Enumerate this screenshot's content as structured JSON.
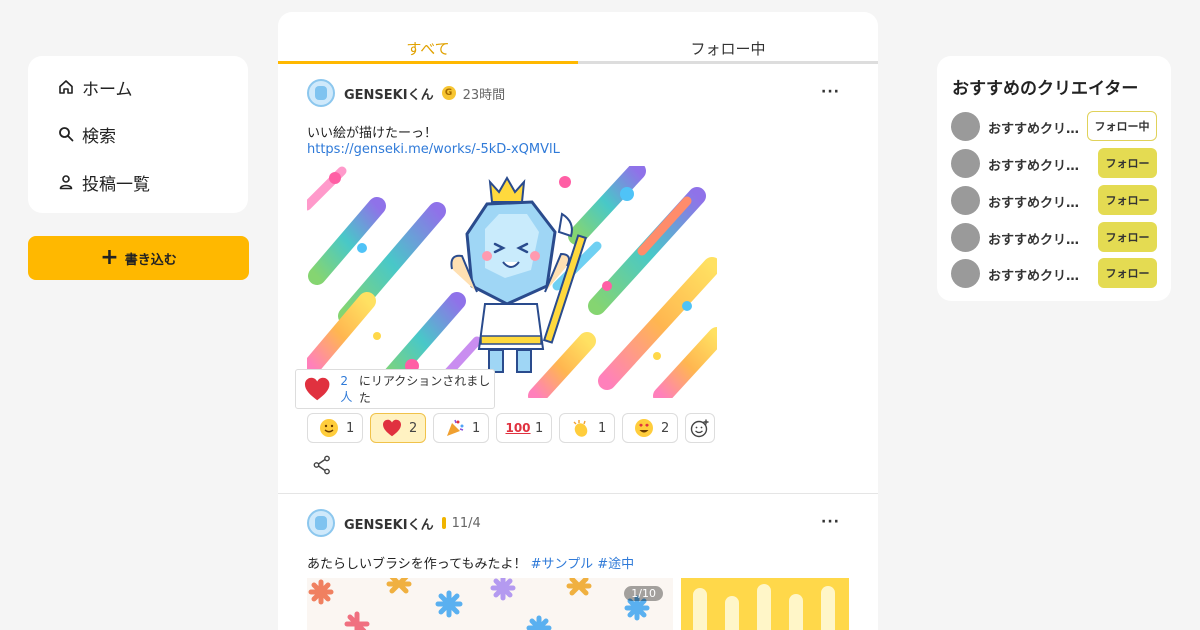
{
  "nav": {
    "home": "ホーム",
    "search": "検索",
    "posts": "投稿一覧",
    "write": "書き込む"
  },
  "tabs": {
    "all": "すべて",
    "following": "フォロー中"
  },
  "posts": [
    {
      "author": "GENSEKIくん",
      "badge": "G",
      "time": "23時間",
      "text": "いい絵が描けたーっ！",
      "link": "https://genseki.me/works/-5kD-xQMVlL",
      "reaction_summary_count": "2人",
      "reaction_summary_text": "にリアクションされました",
      "reactions": [
        {
          "emoji": "smile",
          "count": "1",
          "active": false
        },
        {
          "emoji": "heart",
          "count": "2",
          "active": true
        },
        {
          "emoji": "party",
          "count": "1",
          "active": false
        },
        {
          "emoji": "hundred",
          "count": "1",
          "active": false
        },
        {
          "emoji": "clap",
          "count": "1",
          "active": false
        },
        {
          "emoji": "heart-eyes",
          "count": "2",
          "active": false
        }
      ]
    },
    {
      "author": "GENSEKIくん",
      "time": "11/4",
      "text": "あたらしいブラシを作ってもみたよ！",
      "tag1": "#サンプル",
      "tag2": "#途中",
      "pager": "1/10"
    }
  ],
  "recommend": {
    "title": "おすすめのクリエイター",
    "creators": [
      {
        "name": "おすすめクリエイター",
        "button": "フォロー中"
      },
      {
        "name": "おすすめクリエイター",
        "button": "フォロー"
      },
      {
        "name": "おすすめクリエイター",
        "button": "フォロー"
      },
      {
        "name": "おすすめクリエイター",
        "button": "フォロー"
      },
      {
        "name": "おすすめクリエイター",
        "button": "フォロー"
      }
    ]
  },
  "colors": {
    "accent": "#ffb800",
    "link": "#2f7ad8",
    "follow_button": "#e4db52"
  }
}
